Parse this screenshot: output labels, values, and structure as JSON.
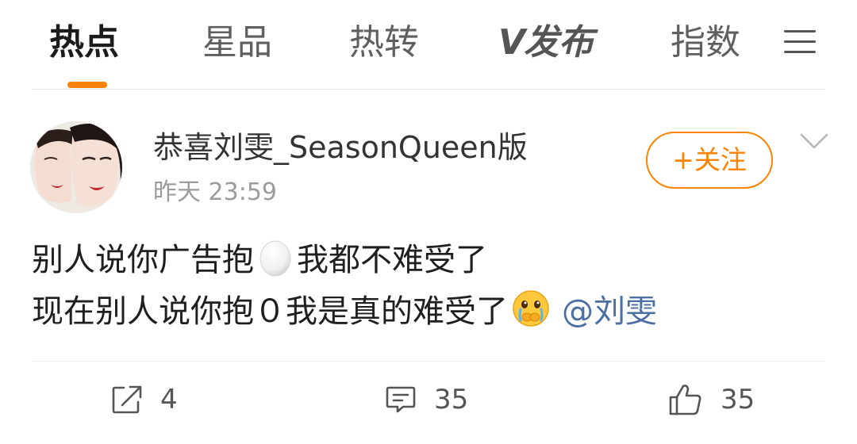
{
  "tabs": [
    {
      "label": "热点",
      "active": true
    },
    {
      "label": "星品",
      "active": false
    },
    {
      "label": "热转",
      "active": false
    },
    {
      "label": "发布",
      "logo_mark": "V",
      "active": false
    },
    {
      "label": "指数",
      "active": false
    }
  ],
  "colors": {
    "accent": "#ff8200",
    "mention": "#4b6fa3",
    "muted": "#9b9b9b"
  },
  "icons": {
    "menu": "hamburger-menu-icon",
    "chevron": "chevron-down-icon",
    "repost": "repost-icon",
    "comment": "comment-icon",
    "like": "thumbs-up-icon",
    "egg_emoji": "egg-emoji",
    "crying_emoji": "crying-face-emoji"
  },
  "post": {
    "username": "恭喜刘雯_SeasonQueen版",
    "time": "昨天 23:59",
    "follow_label": "+关注",
    "line1_before": "别人说你广告抱",
    "line1_after": "我都不难受了",
    "line2_text": "现在别人说你抱０我是真的难受了",
    "mention": "@刘雯"
  },
  "actions": {
    "repost_count": "4",
    "comment_count": "35",
    "like_count": "35"
  }
}
